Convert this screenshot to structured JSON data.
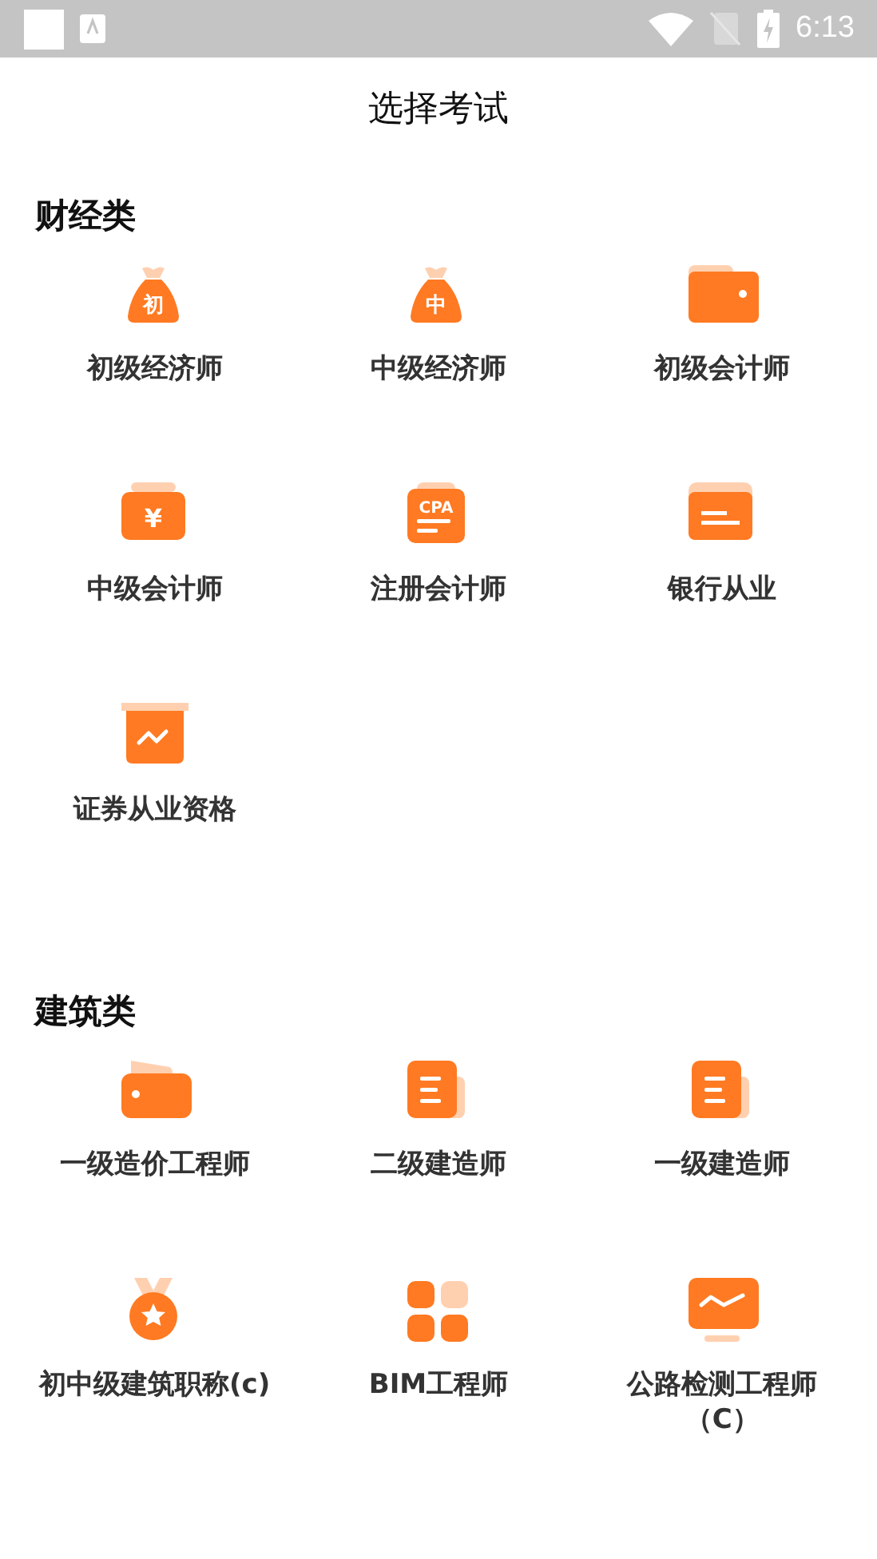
{
  "status_bar": {
    "time": "6:13"
  },
  "header": {
    "title": "选择考试"
  },
  "sections": [
    {
      "title": "财经类",
      "items": [
        {
          "label": "初级经济师",
          "kind": "bag",
          "badge": "初"
        },
        {
          "label": "中级经济师",
          "kind": "bag",
          "badge": "中"
        },
        {
          "label": "初级会计师",
          "kind": "wallet"
        },
        {
          "label": "中级会计师",
          "kind": "money-box",
          "badge": "¥"
        },
        {
          "label": "注册会计师",
          "kind": "cert",
          "badge": "CPA"
        },
        {
          "label": "银行从业",
          "kind": "card"
        },
        {
          "label": "证券从业资格",
          "kind": "chart-box"
        }
      ]
    },
    {
      "title": "建筑类",
      "items": [
        {
          "label": "一级造价工程师",
          "kind": "purse"
        },
        {
          "label": "二级建造师",
          "kind": "document"
        },
        {
          "label": "一级建造师",
          "kind": "document"
        },
        {
          "label": "初中级建筑职称(c)",
          "kind": "medal"
        },
        {
          "label": "BIM工程师",
          "kind": "grid"
        },
        {
          "label": "公路检测工程师（C）",
          "kind": "monitor"
        }
      ]
    }
  ]
}
